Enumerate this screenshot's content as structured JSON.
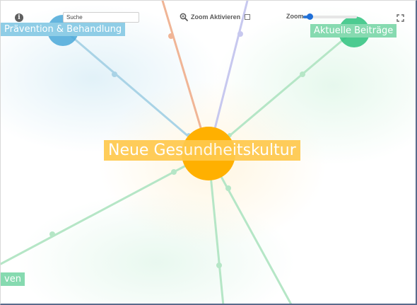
{
  "toolbar": {
    "info_symbol": "i",
    "search_placeholder": "Suche",
    "zoom_activate_label": "Zoom Aktivieren",
    "zoom_label": "Zoom",
    "zoom_level": 0.12,
    "zoom_activated": false
  },
  "graph": {
    "center_label": "Neue Gesundheitskultur",
    "nodes": [
      {
        "label": "Prävention & Behandlung",
        "color": "#4aa8d8",
        "label_bg": "#8fcde6"
      },
      {
        "label": "Aktuelle Beiträge",
        "color": "#2ec27e",
        "label_bg": "#86dab0"
      },
      {
        "label": "ven",
        "color": "#2ec27e",
        "label_bg": "#86dab0"
      }
    ],
    "colors": {
      "center_node": "#ffb000",
      "center_label_bg": "#ffc94d",
      "edge_blue": "#a9d3e6",
      "edge_green": "#b5e6c6",
      "edge_orange": "#f0b596",
      "edge_purple": "#c7c8ef"
    }
  }
}
